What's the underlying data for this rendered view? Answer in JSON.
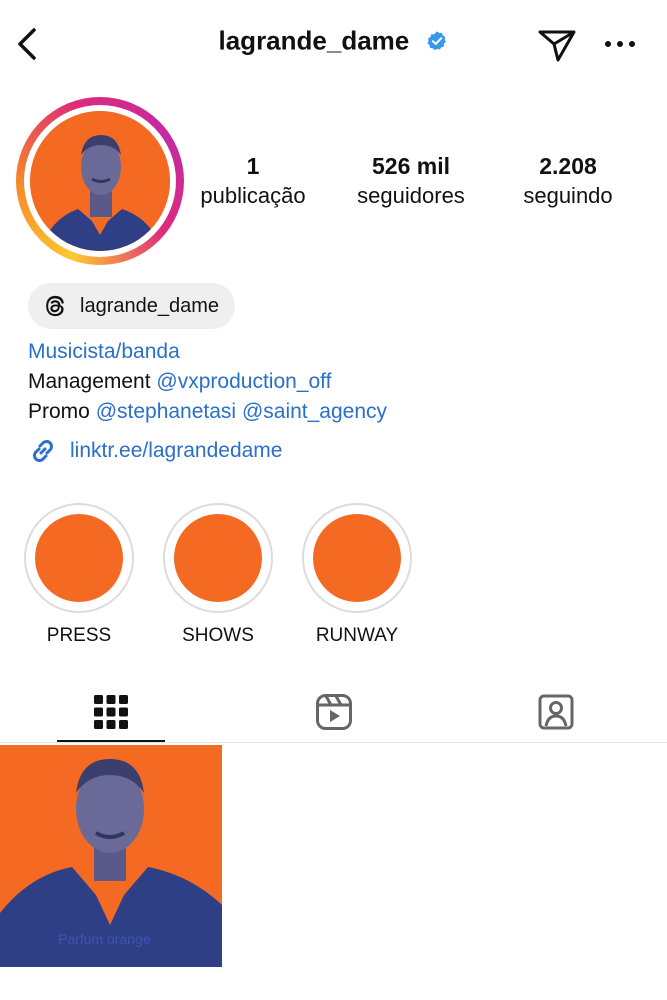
{
  "header": {
    "username": "lagrande_dame"
  },
  "stats": [
    {
      "value": "1",
      "label": "publicação"
    },
    {
      "value": "526 mil",
      "label": "seguidores"
    },
    {
      "value": "2.208",
      "label": "seguindo"
    }
  ],
  "threads": {
    "handle": "lagrande_dame"
  },
  "bio": {
    "category": "Musicista/banda",
    "line1_prefix": "Management ",
    "line1_mention": "@vxproduction_off",
    "line2_prefix": "Promo ",
    "line2_mention1": "@stephanetasi",
    "line2_mention2": "@saint_agency",
    "link": "linktr.ee/lagrandedame"
  },
  "highlights": [
    {
      "label": "PRESS"
    },
    {
      "label": "SHOWS"
    },
    {
      "label": "RUNWAY"
    }
  ],
  "tabs": [
    {
      "icon": "grid-icon",
      "selected": true
    },
    {
      "icon": "reels-icon",
      "selected": false
    },
    {
      "icon": "tagged-icon",
      "selected": false
    }
  ],
  "posts": [
    {
      "caption": "Parfum orange"
    }
  ],
  "colors": {
    "accent_orange": "#f56a23",
    "duotone_blue": "#3f57b8",
    "link_blue": "#2a6fc9",
    "verified_blue": "#3897f0"
  }
}
